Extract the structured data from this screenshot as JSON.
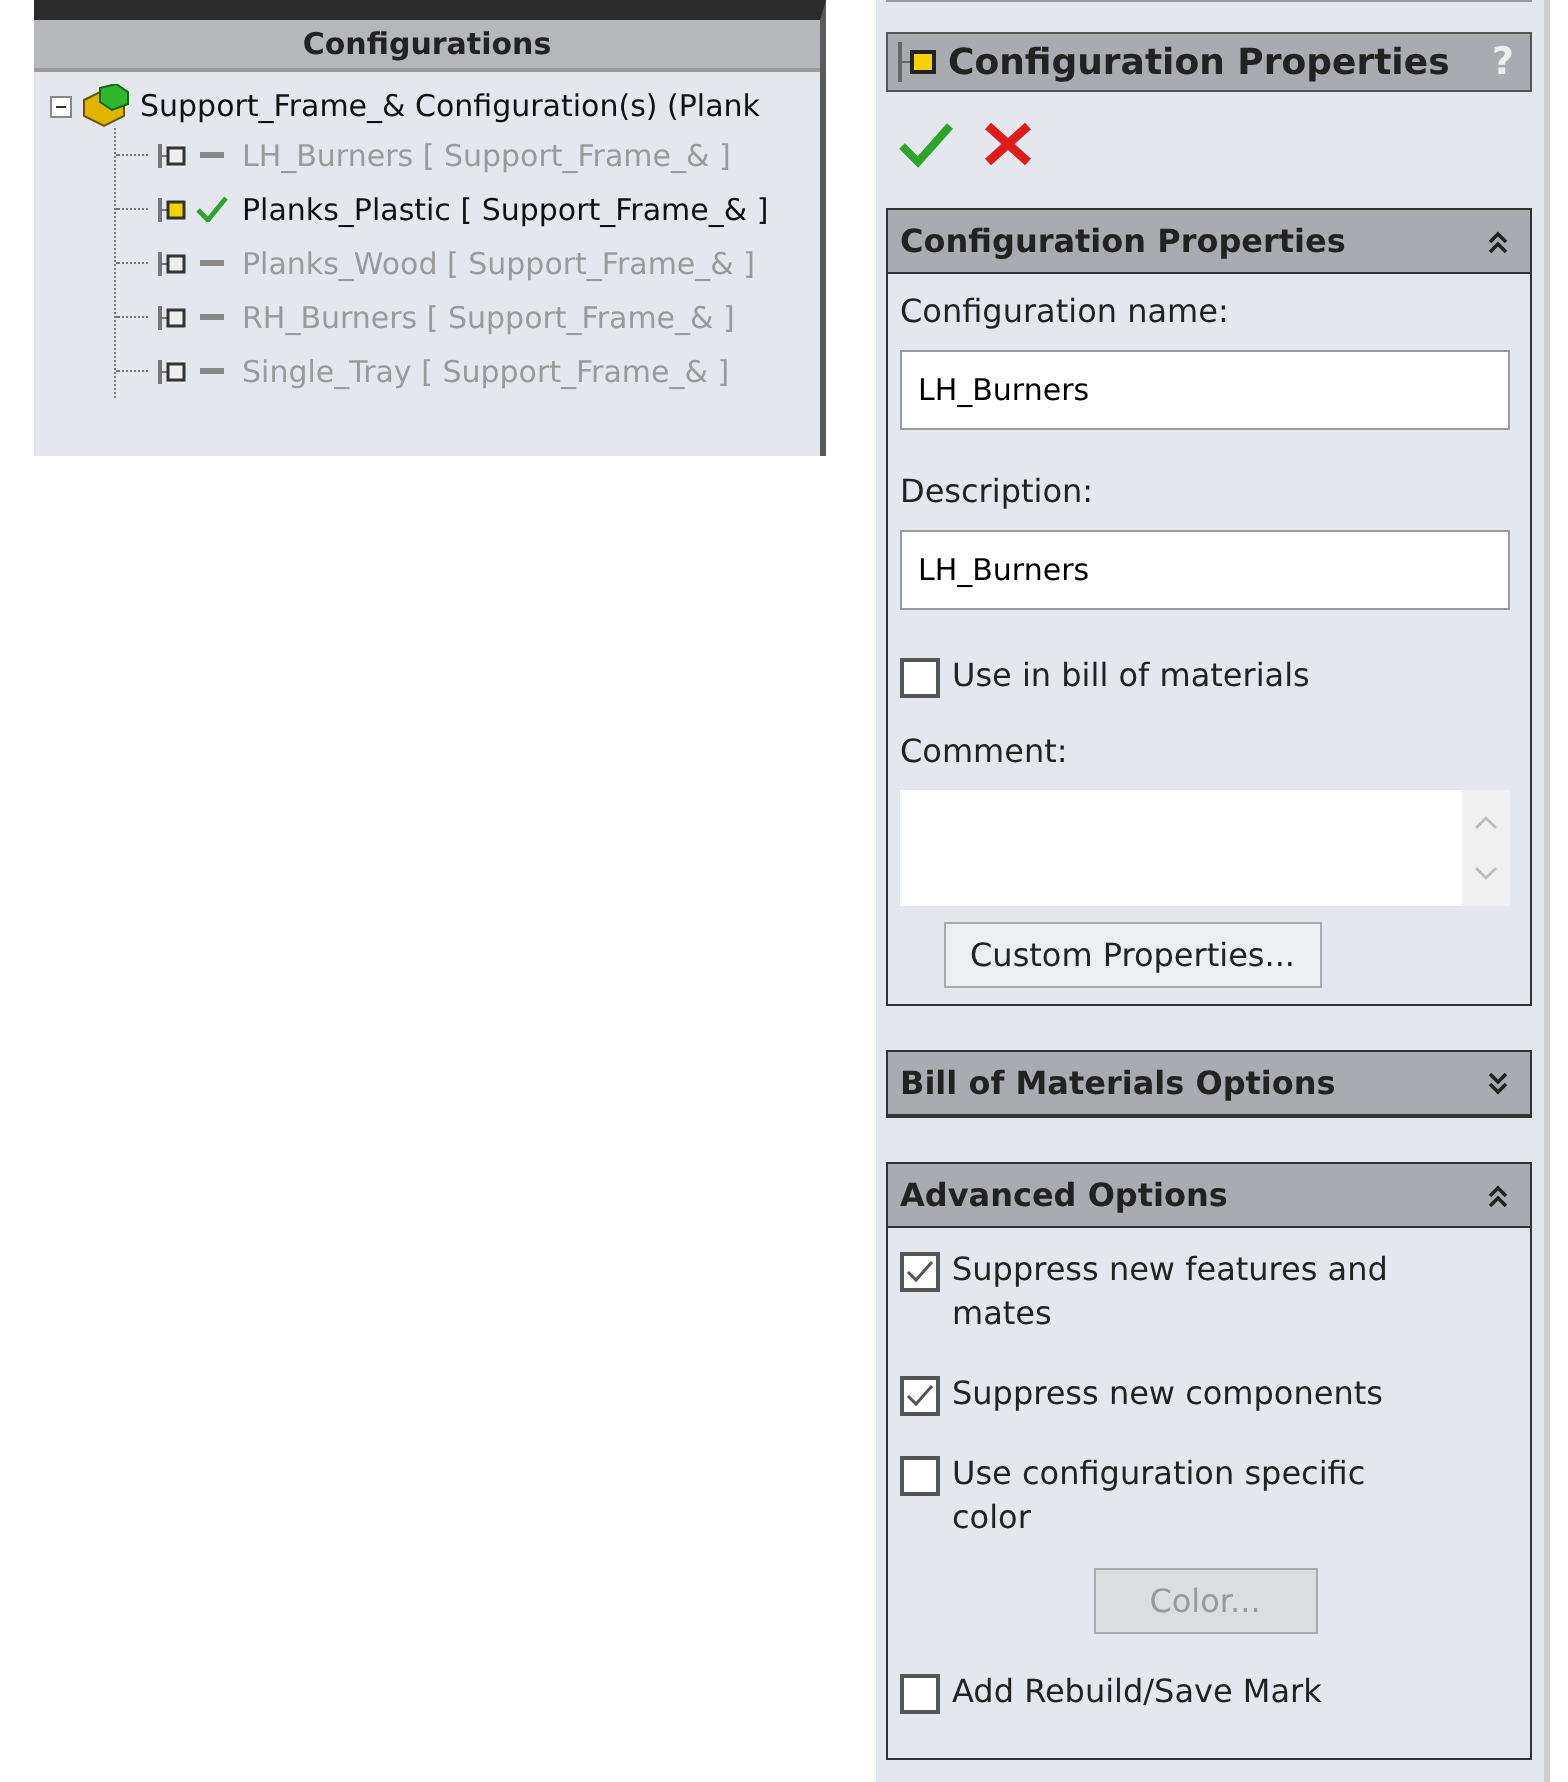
{
  "tree": {
    "title": "Configurations",
    "root": {
      "label": "Support_Frame_& Configuration(s)  (Plank",
      "expanded": true,
      "children": [
        {
          "label": "LH_Burners [ Support_Frame_& ]",
          "active": false
        },
        {
          "label": "Planks_Plastic [ Support_Frame_& ]",
          "active": true
        },
        {
          "label": "Planks_Wood [ Support_Frame_& ]",
          "active": false
        },
        {
          "label": "RH_Burners [ Support_Frame_& ]",
          "active": false
        },
        {
          "label": "Single_Tray [ Support_Frame_& ]",
          "active": false
        }
      ]
    }
  },
  "property_manager": {
    "title": "Configuration Properties",
    "help": "?",
    "sections": [
      {
        "kind": "properties",
        "title": "Configuration Properties",
        "expanded": true,
        "name_label": "Configuration name:",
        "name_value": "LH_Burners",
        "description_label": "Description:",
        "description_value": "LH_Burners",
        "bom_checkbox": {
          "label": "Use in bill of materials",
          "checked": false
        },
        "comment_label": "Comment:",
        "button": "Custom Properties..."
      },
      {
        "title": "Bill of Materials Options",
        "expanded": false
      },
      {
        "kind": "options",
        "title": "Advanced Options",
        "expanded": true,
        "options": [
          {
            "kind": "checkbox",
            "label": "Suppress new features and mates",
            "checked": true
          },
          {
            "kind": "checkbox",
            "label": "Suppress new components",
            "checked": true
          },
          {
            "kind": "checkbox",
            "label": "Use configuration specific color",
            "checked": false
          },
          {
            "kind": "button",
            "label": "Color...",
            "disabled": true
          },
          {
            "kind": "checkbox",
            "label": "Add Rebuild/Save Mark",
            "checked": false
          }
        ]
      }
    ]
  }
}
